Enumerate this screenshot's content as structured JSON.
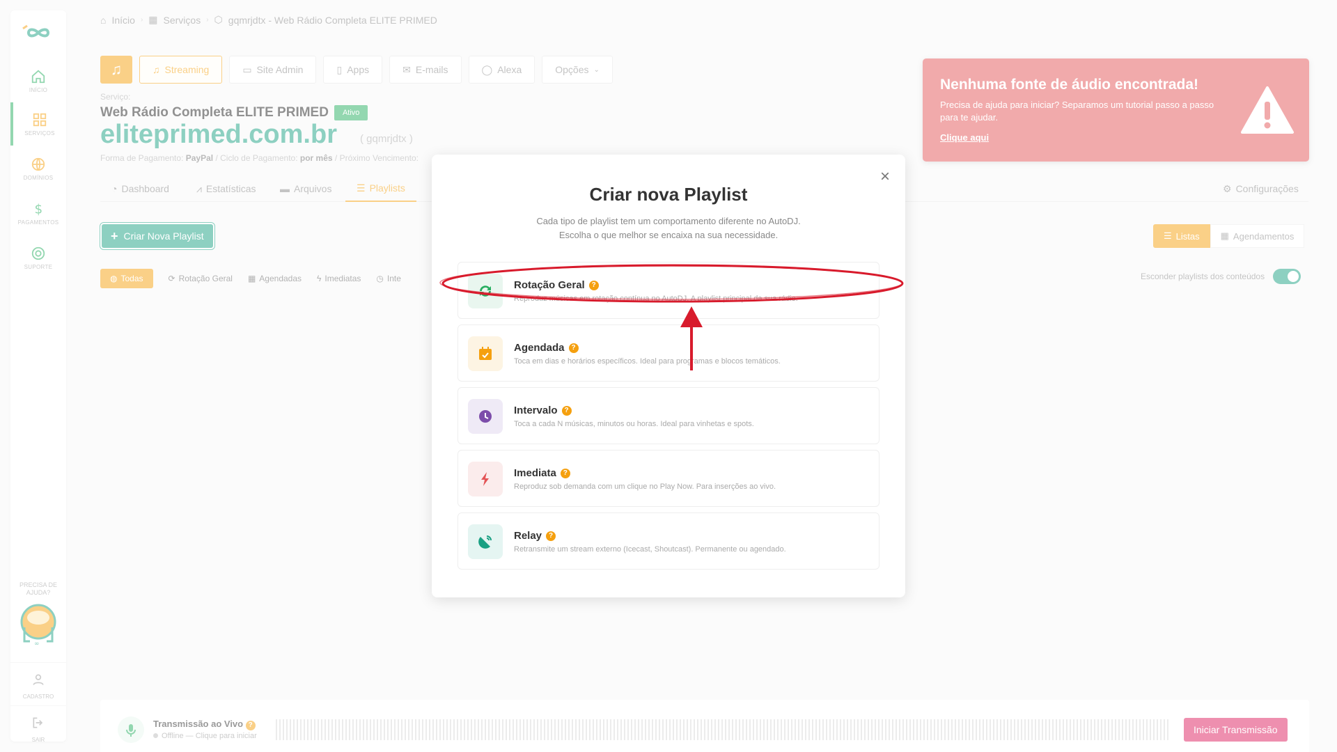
{
  "sidebar": {
    "items": [
      {
        "label": "INÍCIO"
      },
      {
        "label": "SERVIÇOS"
      },
      {
        "label": "DOMÍNIOS"
      },
      {
        "label": "PAGAMENTOS"
      },
      {
        "label": "SUPORTE"
      }
    ],
    "help": "PRECISA DE AJUDA?",
    "cadastro": "CADASTRO",
    "sair": "SAIR"
  },
  "breadcrumb": {
    "home": "Início",
    "services": "Serviços",
    "current": "gqmrjdtx - Web Rádio Completa ELITE PRIMED"
  },
  "topbar": {
    "streaming": "Streaming",
    "site_admin": "Site Admin",
    "apps": "Apps",
    "emails": "E-mails",
    "alexa": "Alexa",
    "options": "Opções"
  },
  "service": {
    "label": "Serviço:",
    "name": "Web Rádio Completa ELITE PRIMED",
    "status": "Ativo",
    "domain": "eliteprimed.com.br",
    "id": "( gqmrjdtx )",
    "payment_label": "Forma de Pagamento:",
    "payment": "PayPal",
    "cycle_label": "Ciclo de Pagamento:",
    "cycle": "por mês",
    "next_label": "Próximo Vencimento:"
  },
  "tabs": {
    "dashboard": "Dashboard",
    "stats": "Estatísticas",
    "files": "Arquivos",
    "playlists": "Playlists",
    "settings": "Configurações"
  },
  "actions": {
    "create": "Criar Nova Playlist",
    "lists": "Listas",
    "schedules": "Agendamentos"
  },
  "filters": {
    "all": "Todas",
    "rotation": "Rotação Geral",
    "scheduled": "Agendadas",
    "immediate": "Imediatas",
    "interval": "Inte"
  },
  "hide_label": "Esconder playlists dos conteúdos",
  "alert": {
    "title": "Nenhuma fonte de áudio encontrada!",
    "text": "Precisa de ajuda para iniciar? Separamos um tutorial passo a passo para te ajudar.",
    "link": "Clique aqui"
  },
  "live": {
    "title": "Transmissão ao Vivo",
    "status": "Offline — Clique para iniciar",
    "button": "Iniciar Transmissão"
  },
  "modal": {
    "title": "Criar nova Playlist",
    "desc1": "Cada tipo de playlist tem um comportamento diferente no AutoDJ.",
    "desc2": "Escolha o que melhor se encaixa na sua necessidade.",
    "options": [
      {
        "title": "Rotação Geral",
        "desc": "Reproduz músicas em rotação contínua no AutoDJ. A playlist principal da sua rádio."
      },
      {
        "title": "Agendada",
        "desc": "Toca em dias e horários específicos. Ideal para programas e blocos temáticos."
      },
      {
        "title": "Intervalo",
        "desc": "Toca a cada N músicas, minutos ou horas. Ideal para vinhetas e spots."
      },
      {
        "title": "Imediata",
        "desc": "Reproduz sob demanda com um clique no Play Now. Para inserções ao vivo."
      },
      {
        "title": "Relay",
        "desc": "Retransmite um stream externo (Icecast, Shoutcast). Permanente ou agendado."
      }
    ]
  },
  "colors": {
    "accent": "#f5a00f",
    "brand": "#1aa083",
    "danger": "#e35456",
    "live": "#dc1f5e"
  }
}
